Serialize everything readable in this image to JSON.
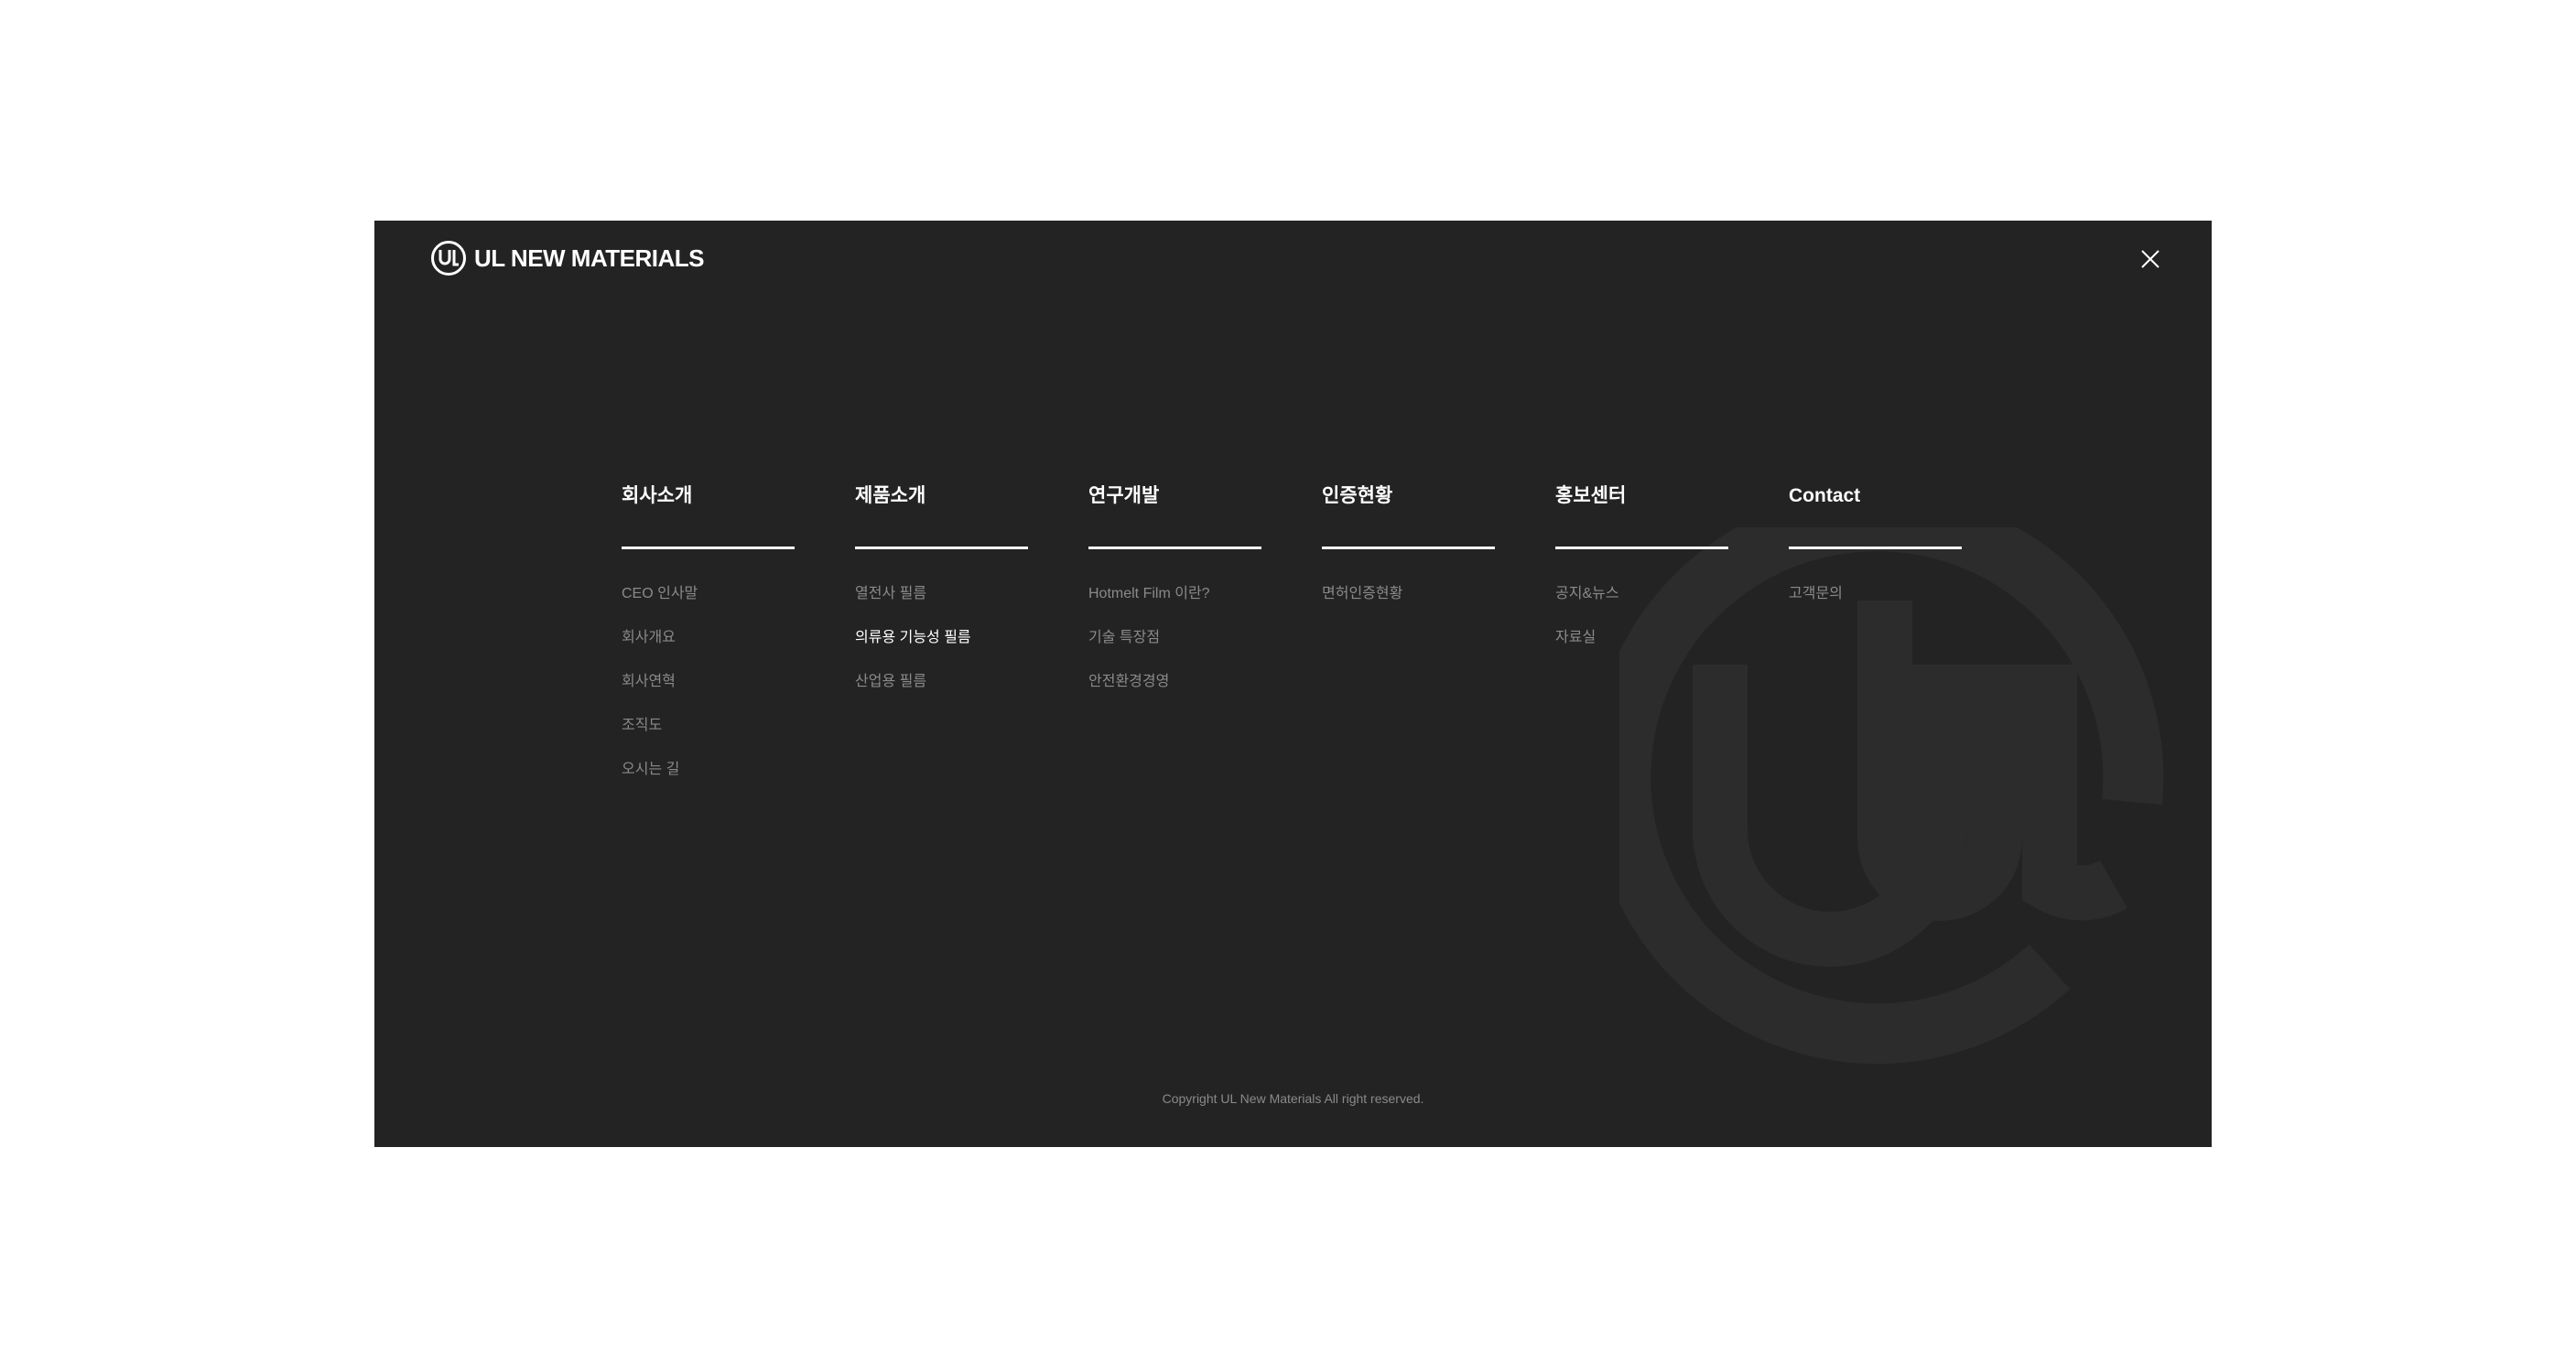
{
  "brand": {
    "name": "UL NEW MATERIALS",
    "logo_icon": "ul-monogram-icon",
    "watermark_icon": "ul-monogram-watermark-icon"
  },
  "close": {
    "icon": "close-icon"
  },
  "menu": [
    {
      "title": "회사소개",
      "items": [
        {
          "label": "CEO 인사말",
          "active": false
        },
        {
          "label": "회사개요",
          "active": false
        },
        {
          "label": "회사연혁",
          "active": false
        },
        {
          "label": "조직도",
          "active": false
        },
        {
          "label": "오시는 길",
          "active": false
        }
      ]
    },
    {
      "title": "제품소개",
      "items": [
        {
          "label": "열전사 필름",
          "active": false
        },
        {
          "label": "의류용 기능성 필름",
          "active": true
        },
        {
          "label": "산업용 필름",
          "active": false
        }
      ]
    },
    {
      "title": "연구개발",
      "items": [
        {
          "label": "Hotmelt Film 이란?",
          "active": false
        },
        {
          "label": "기술 특장점",
          "active": false
        },
        {
          "label": "안전환경경영",
          "active": false
        }
      ]
    },
    {
      "title": "인증현황",
      "items": [
        {
          "label": "면허인증현황",
          "active": false
        }
      ]
    },
    {
      "title": "홍보센터",
      "items": [
        {
          "label": "공지&뉴스",
          "active": false
        },
        {
          "label": "자료실",
          "active": false
        }
      ]
    },
    {
      "title": "Contact",
      "items": [
        {
          "label": "고객문의",
          "active": false
        }
      ]
    }
  ],
  "footer": {
    "copyright": "Copyright UL New Materials All right reserved."
  },
  "colors": {
    "panel_bg": "#232323",
    "text_primary": "#ffffff",
    "text_muted": "#8a8a8a",
    "watermark": "#2c2c2c"
  }
}
